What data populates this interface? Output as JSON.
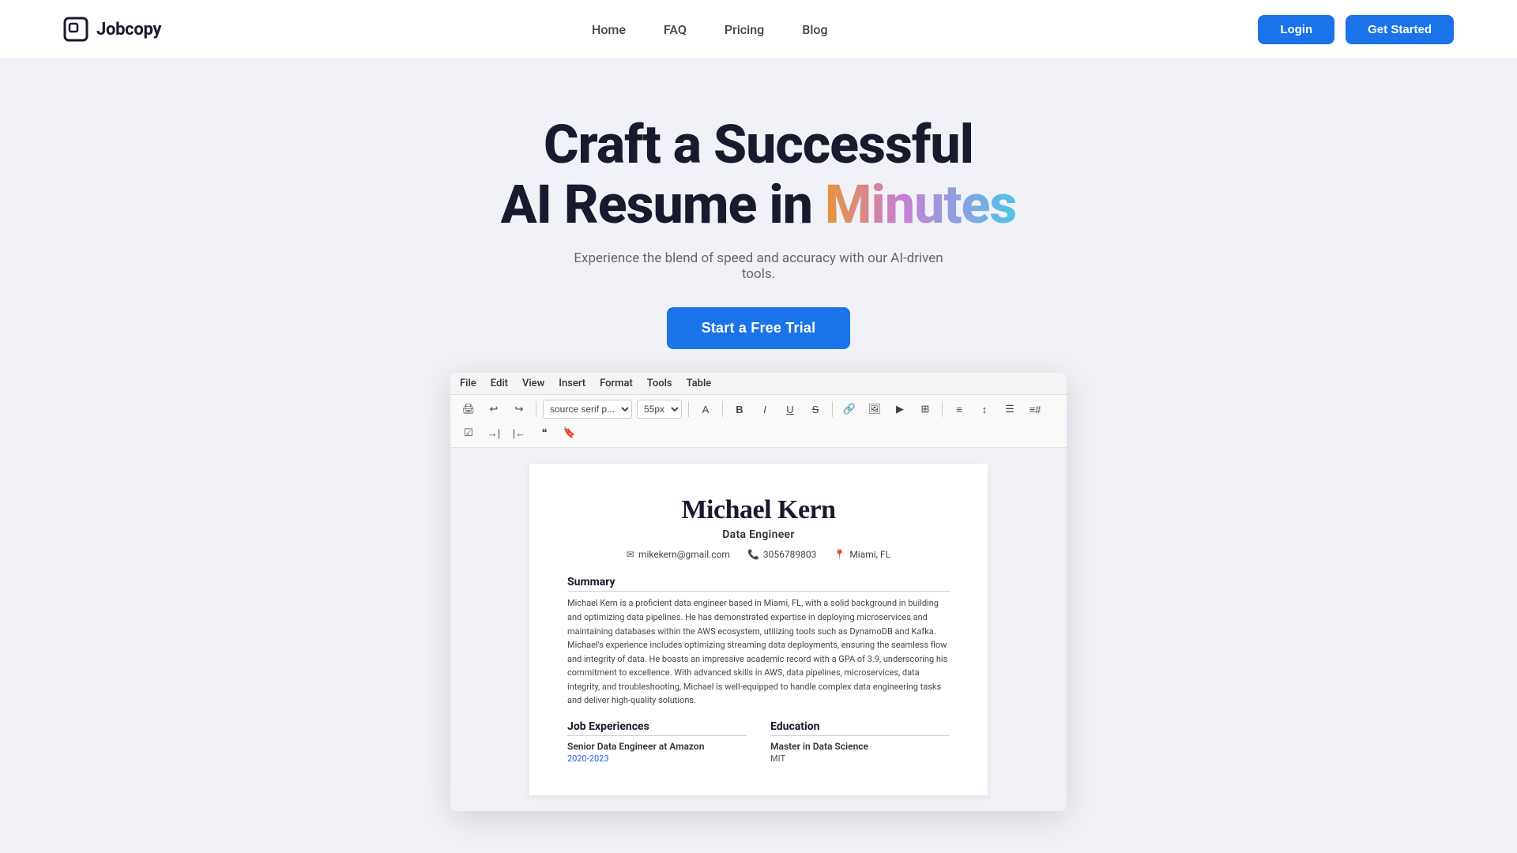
{
  "brand": {
    "logo_text": "Jobcopy",
    "logo_icon": "□"
  },
  "navbar": {
    "links": [
      {
        "label": "Home",
        "id": "home"
      },
      {
        "label": "FAQ",
        "id": "faq"
      },
      {
        "label": "Pricing",
        "id": "pricing"
      },
      {
        "label": "Blog",
        "id": "blog"
      }
    ],
    "login_label": "Login",
    "get_started_label": "Get Started"
  },
  "hero": {
    "headline_line1": "Craft a Successful",
    "headline_line2_pre": "AI Resume in ",
    "headline_line2_accent": "Minutes",
    "subtitle": "Experience the blend of speed and accuracy with our AI-driven tools.",
    "cta_label": "Start a Free  Trial"
  },
  "editor": {
    "menubar": [
      "File",
      "Edit",
      "View",
      "Insert",
      "Format",
      "Tools",
      "Table"
    ],
    "toolbar": {
      "font": "source serif p...",
      "size": "55px",
      "bold": "B",
      "italic": "I",
      "underline": "U",
      "strikethrough": "S"
    }
  },
  "resume": {
    "name": "Michael Kern",
    "title": "Data Engineer",
    "contact": {
      "email": "mikekern@gmail.com",
      "phone": "3056789803",
      "location": "Miami, FL"
    },
    "summary_title": "Summary",
    "summary_text": "Michael Kern is a proficient data engineer based in Miami, FL, with a solid background in building and optimizing data pipelines. He has demonstrated expertise in deploying microservices and maintaining databases within the AWS ecosystem, utilizing tools such as DynamoDB and Kafka. Michael's experience includes optimizing streaming data deployments, ensuring the seamless flow and integrity of data. He boasts an impressive academic record with a GPA of 3.9, underscoring his commitment to excellence. With advanced skills in AWS, data pipelines, microservices, data integrity, and troubleshooting, Michael is well-equipped to handle complex data engineering tasks and deliver high-quality solutions.",
    "job_experiences_title": "Job Experiences",
    "job_title": "Senior Data Engineer at Amazon",
    "job_date": "2020-2023",
    "education_title": "Education",
    "edu_degree": "Master in Data Science",
    "edu_school": "MIT"
  },
  "colors": {
    "accent_blue": "#1a73e8",
    "gradient_start": "#e8943a",
    "gradient_mid": "#c97fd4",
    "gradient_end": "#4fc3e8",
    "bg": "#f0f2f8",
    "white": "#ffffff"
  }
}
